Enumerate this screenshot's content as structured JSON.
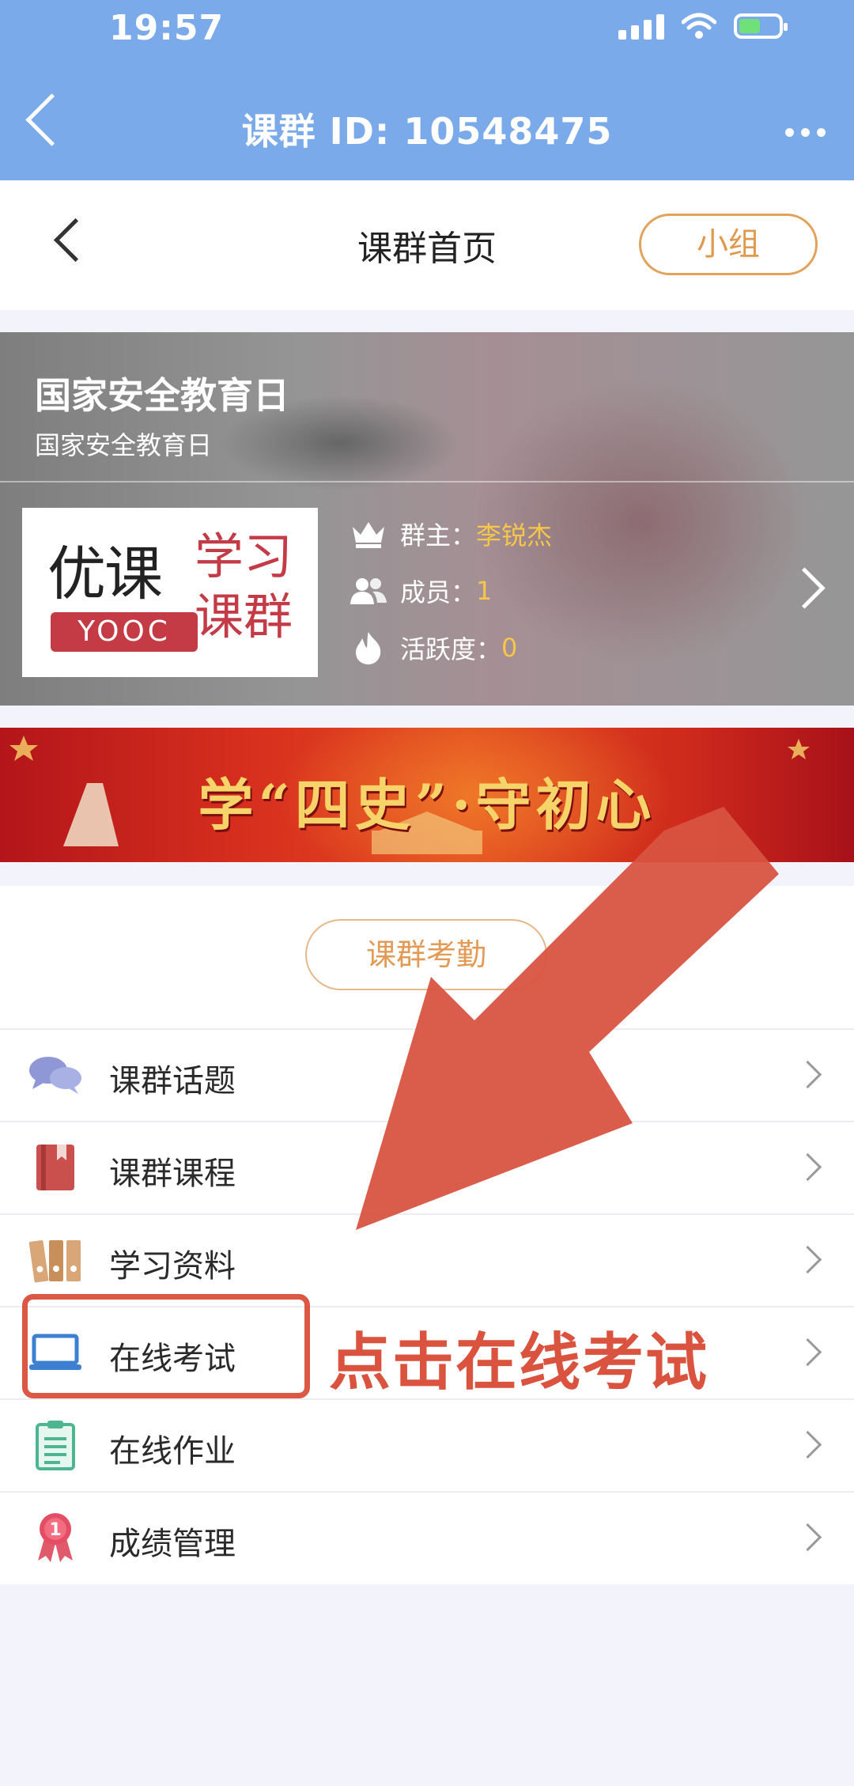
{
  "status_bar": {
    "time": "19:57"
  },
  "nav": {
    "title": "课群 ID: 10548475"
  },
  "page_header": {
    "title": "课群首页",
    "group_button": "小组"
  },
  "course": {
    "name": "国家安全教育日",
    "subtitle": "国家安全教育日",
    "logo": {
      "line1": "优课",
      "badge": "YOOC",
      "line2": "学习课群"
    },
    "owner_label": "群主：",
    "owner_value": "李锐杰",
    "members_label": "成员：",
    "members_value": "1",
    "activity_label": "活跃度：",
    "activity_value": "0"
  },
  "promo_banner": {
    "text": "学“四史”·守初心"
  },
  "attendance_button": "课群考勤",
  "menu": [
    {
      "label": "课群话题",
      "icon": "chat-bubbles-icon"
    },
    {
      "label": "课群课程",
      "icon": "book-icon"
    },
    {
      "label": "学习资料",
      "icon": "binders-icon"
    },
    {
      "label": "在线考试",
      "icon": "laptop-icon"
    },
    {
      "label": "在线作业",
      "icon": "clipboard-icon"
    },
    {
      "label": "成绩管理",
      "icon": "medal-icon"
    }
  ],
  "annotation": {
    "text": "点击在线考试",
    "color": "#d9533f"
  },
  "colors": {
    "nav_bg": "#7aaae9",
    "accent_orange": "#e39a55",
    "highlight_yellow": "#f5c64a"
  }
}
